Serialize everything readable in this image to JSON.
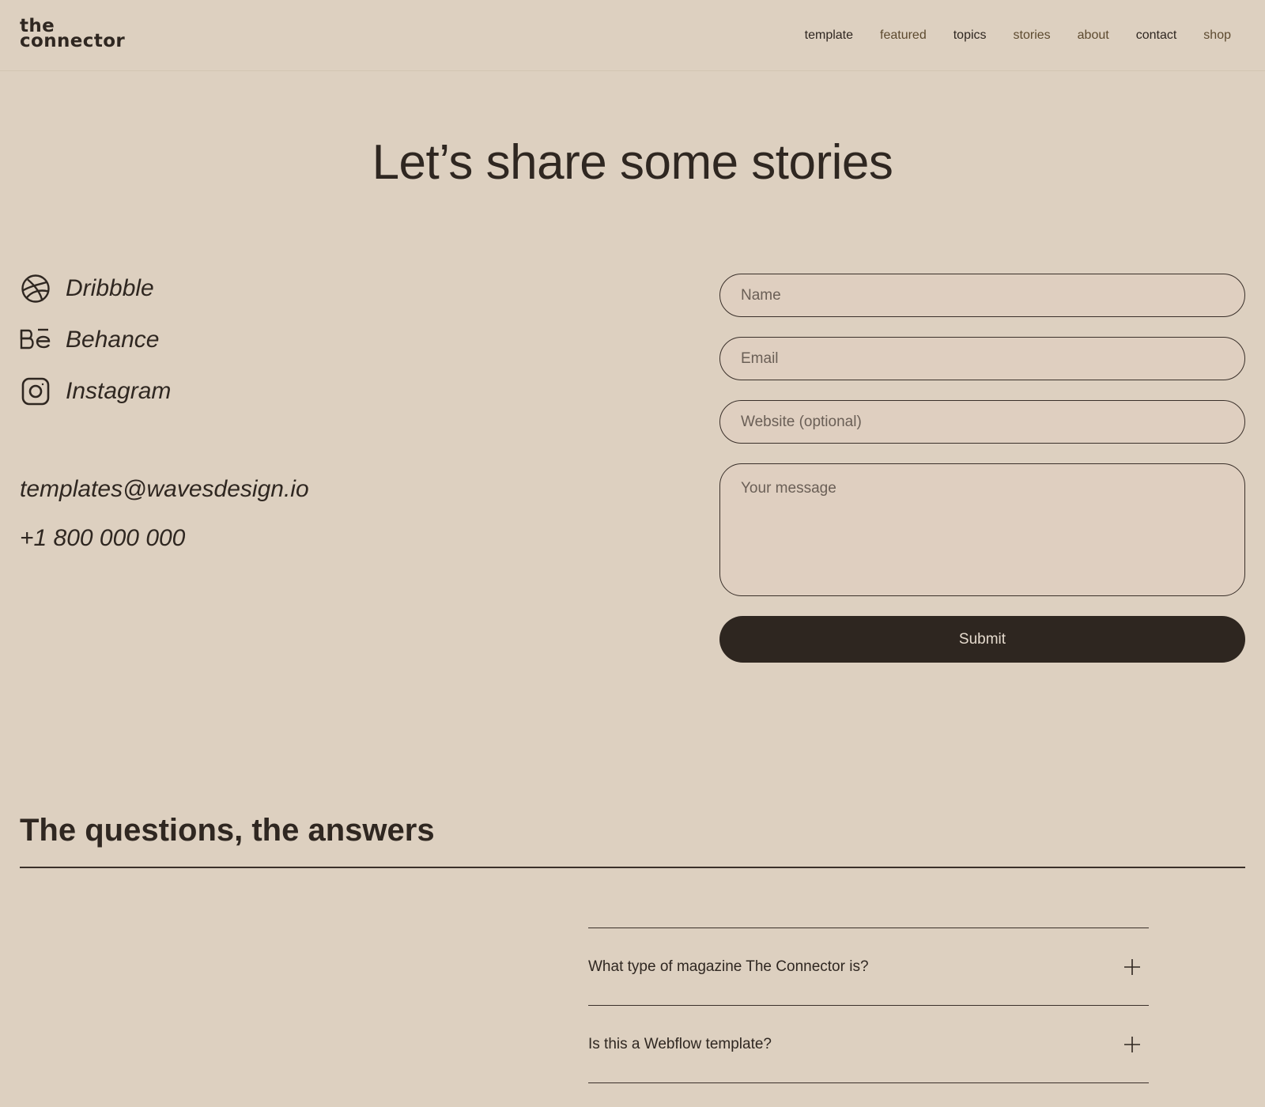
{
  "header": {
    "logo_line1": "the",
    "logo_line2": "connector",
    "nav": [
      {
        "label": "template",
        "name": "nav-template"
      },
      {
        "label": "featured",
        "name": "nav-featured"
      },
      {
        "label": "topics",
        "name": "nav-topics"
      },
      {
        "label": "stories",
        "name": "nav-stories"
      },
      {
        "label": "about",
        "name": "nav-about"
      },
      {
        "label": "contact",
        "name": "nav-contact"
      },
      {
        "label": "shop",
        "name": "nav-shop"
      }
    ]
  },
  "hero": {
    "title": "Let’s share some stories"
  },
  "socials": [
    {
      "label": "Dribbble",
      "icon": "dribbble-icon"
    },
    {
      "label": "Behance",
      "icon": "behance-icon"
    },
    {
      "label": "Instagram",
      "icon": "instagram-icon"
    }
  ],
  "contact": {
    "email": "templates@wavesdesign.io",
    "phone": "+1 800 000 000"
  },
  "form": {
    "name_placeholder": "Name",
    "email_placeholder": "Email",
    "website_placeholder": "Website (optional)",
    "message_placeholder": "Your message",
    "submit_label": "Submit"
  },
  "faq": {
    "title": "The questions, the answers",
    "items": [
      {
        "question": "What type of magazine The Connector is?",
        "icon": "plus-icon"
      },
      {
        "question": "Is this a Webflow template?",
        "icon": "plus-icon"
      }
    ]
  },
  "colors": {
    "background": "#ddd0c0",
    "text": "#2f2721",
    "button": "#2e2620",
    "accent_nav": "#5d4a2f"
  }
}
